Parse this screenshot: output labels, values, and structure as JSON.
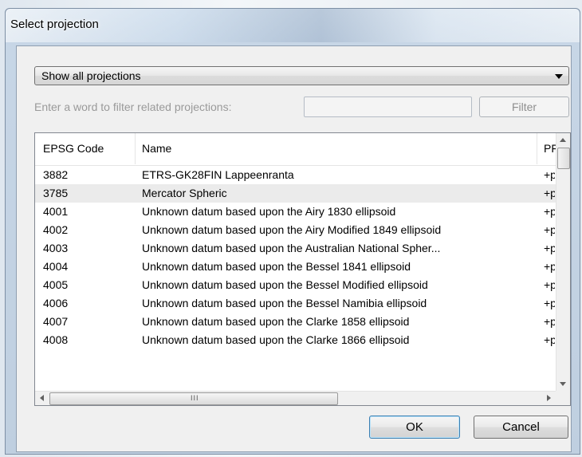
{
  "window": {
    "title": "Select projection"
  },
  "filter": {
    "combo_value": "Show all projections",
    "label": "Enter a word to filter related projections:",
    "input_value": "",
    "button_label": "Filter"
  },
  "table": {
    "columns": [
      "EPSG Code",
      "Name",
      "PF"
    ],
    "rows": [
      {
        "code": "3882",
        "name": "ETRS-GK28FIN Lappeenranta",
        "proj": "+p",
        "selected": false
      },
      {
        "code": "3785",
        "name": "Mercator Spheric",
        "proj": "+p",
        "selected": true
      },
      {
        "code": "4001",
        "name": "Unknown datum based upon the Airy 1830 ellipsoid",
        "proj": "+p",
        "selected": false
      },
      {
        "code": "4002",
        "name": "Unknown datum based upon the Airy Modified 1849 ellipsoid",
        "proj": "+p",
        "selected": false
      },
      {
        "code": "4003",
        "name": "Unknown datum based upon the Australian National Spher...",
        "proj": "+p",
        "selected": false
      },
      {
        "code": "4004",
        "name": "Unknown datum based upon the Bessel 1841 ellipsoid",
        "proj": "+p",
        "selected": false
      },
      {
        "code": "4005",
        "name": "Unknown datum based upon the Bessel Modified ellipsoid",
        "proj": "+p",
        "selected": false
      },
      {
        "code": "4006",
        "name": "Unknown datum based upon the Bessel Namibia ellipsoid",
        "proj": "+p",
        "selected": false
      },
      {
        "code": "4007",
        "name": "Unknown datum based upon the Clarke 1858 ellipsoid",
        "proj": "+p",
        "selected": false
      },
      {
        "code": "4008",
        "name": "Unknown datum based upon the Clarke 1866 ellipsoid",
        "proj": "+p",
        "selected": false
      }
    ],
    "hscroll_grip": "III"
  },
  "buttons": {
    "ok": "OK",
    "cancel": "Cancel"
  },
  "icons": {
    "combo_arrow": "chevron-down-icon",
    "scroll_up": "arrow-up-icon",
    "scroll_down": "arrow-down-icon",
    "scroll_left": "arrow-left-icon",
    "scroll_right": "arrow-right-icon"
  }
}
